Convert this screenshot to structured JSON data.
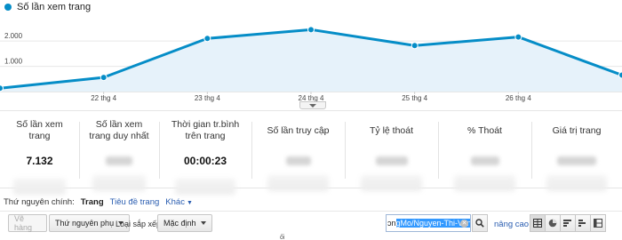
{
  "chart_data": {
    "type": "area",
    "series": [
      {
        "name": "Số lần xem trang",
        "values": [
          130,
          560,
          2100,
          2450,
          1820,
          2160,
          650
        ]
      }
    ],
    "x_tick_labels": [
      "22 thg 4",
      "23 thg 4",
      "24 thg 4",
      "25 thg 4",
      "26 thg 4"
    ],
    "y_tick_labels": [
      "2.000",
      "1.000"
    ],
    "ylim": [
      0,
      3200
    ],
    "grid": true,
    "legend": "top-left",
    "line_color": "#058dc7",
    "fill_color": "#e6f2fa"
  },
  "metrics": [
    {
      "label": "Số lần xem trang",
      "value": "7.132"
    },
    {
      "label": "Số lần xem trang duy nhất",
      "value": ""
    },
    {
      "label": "Thời gian tr.bình trên trang",
      "value": "00:00:23"
    },
    {
      "label": "Số lần truy cập",
      "value": ""
    },
    {
      "label": "Tỷ lệ thoát",
      "value": ""
    },
    {
      "label": "% Thoát",
      "value": ""
    },
    {
      "label": "Giá trị trang",
      "value": ""
    }
  ],
  "dimension": {
    "label": "Thứ nguyên chính:",
    "active": "Trang",
    "links": [
      "Tiêu đề trang",
      "Khác"
    ]
  },
  "toolbar": {
    "view_button": "Vẽ hàng",
    "secondary_dim": "Thứ nguyên phụ",
    "sort_label": "Loại sắp xếp:",
    "sort_value": "Mặc định",
    "search_prefix": "ɔn",
    "search_selected": "gMo/Nguyen-Thi-Van",
    "advanced": "nâng cao"
  },
  "footer_fragment": "ối"
}
